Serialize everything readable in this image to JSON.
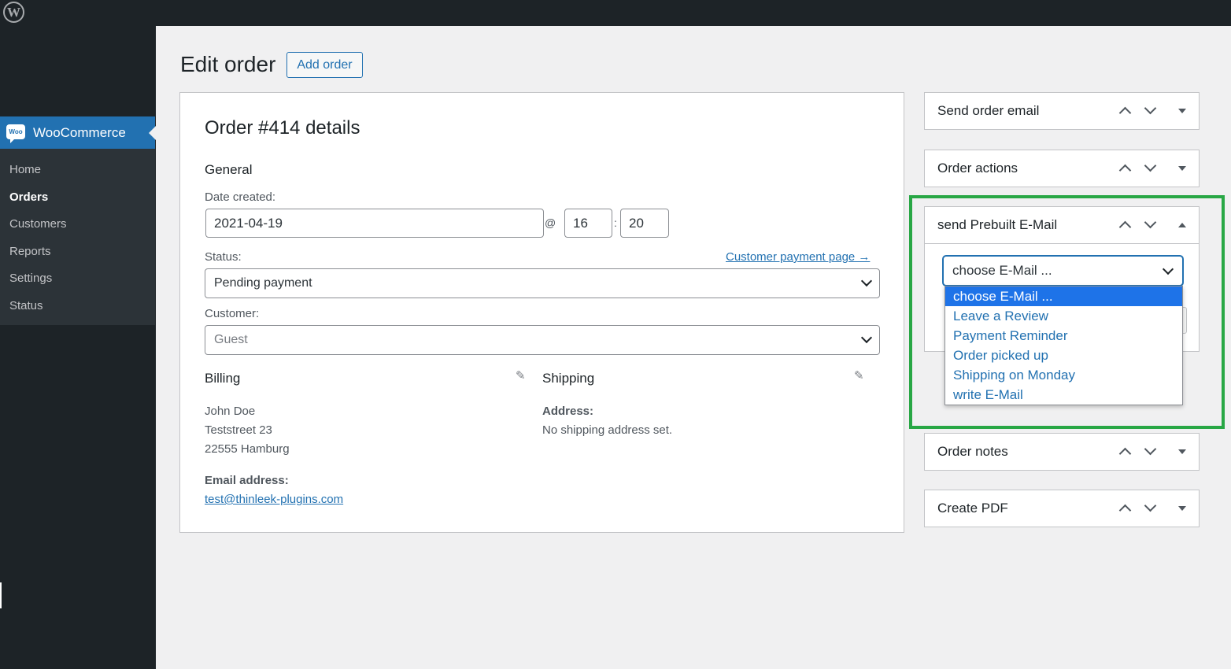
{
  "adminbar": {
    "logo_icon": "wordpress-icon",
    "logo_glyph": "W"
  },
  "sidebar": {
    "plugin_label": "WooCommerce",
    "plugin_icon_text": "Woo",
    "items": [
      {
        "label": "Home",
        "current": false
      },
      {
        "label": "Orders",
        "current": true
      },
      {
        "label": "Customers",
        "current": false
      },
      {
        "label": "Reports",
        "current": false
      },
      {
        "label": "Settings",
        "current": false
      },
      {
        "label": "Status",
        "current": false
      }
    ]
  },
  "header": {
    "title": "Edit order",
    "add_button": "Add order"
  },
  "order": {
    "title": "Order #414 details",
    "general_heading": "General",
    "date_label": "Date created:",
    "date_value": "2021-04-19",
    "at_sign": "@",
    "hour_value": "16",
    "time_sep": ":",
    "minute_value": "20",
    "status_label": "Status:",
    "payment_link": "Customer payment page →",
    "status_value": "Pending payment",
    "customer_label": "Customer:",
    "customer_value": "Guest",
    "billing": {
      "heading": "Billing",
      "name": "John Doe",
      "street": "Teststreet 23",
      "city": "22555 Hamburg",
      "email_label": "Email address:",
      "email": "test@thinleek-plugins.com"
    },
    "shipping": {
      "heading": "Shipping",
      "address_label": "Address:",
      "address_value": "No shipping address set."
    },
    "edit_icon_glyph": "✎"
  },
  "boxes": {
    "send_order_email": "Send order email",
    "order_actions": "Order actions",
    "prebuilt": "send Prebuilt E-Mail",
    "order_notes": "Order notes",
    "create_pdf": "Create PDF"
  },
  "prebuilt_email": {
    "selected": "choose E-Mail ...",
    "options": [
      "choose E-Mail ...",
      "Leave a Review",
      "Payment Reminder",
      "Order picked up",
      "Shipping on Monday",
      "write E-Mail"
    ]
  },
  "colors": {
    "accent": "#2271b1",
    "highlight": "#28a745",
    "sidebar_bg": "#1d2327",
    "dropdown_selected": "#1e73e8"
  }
}
